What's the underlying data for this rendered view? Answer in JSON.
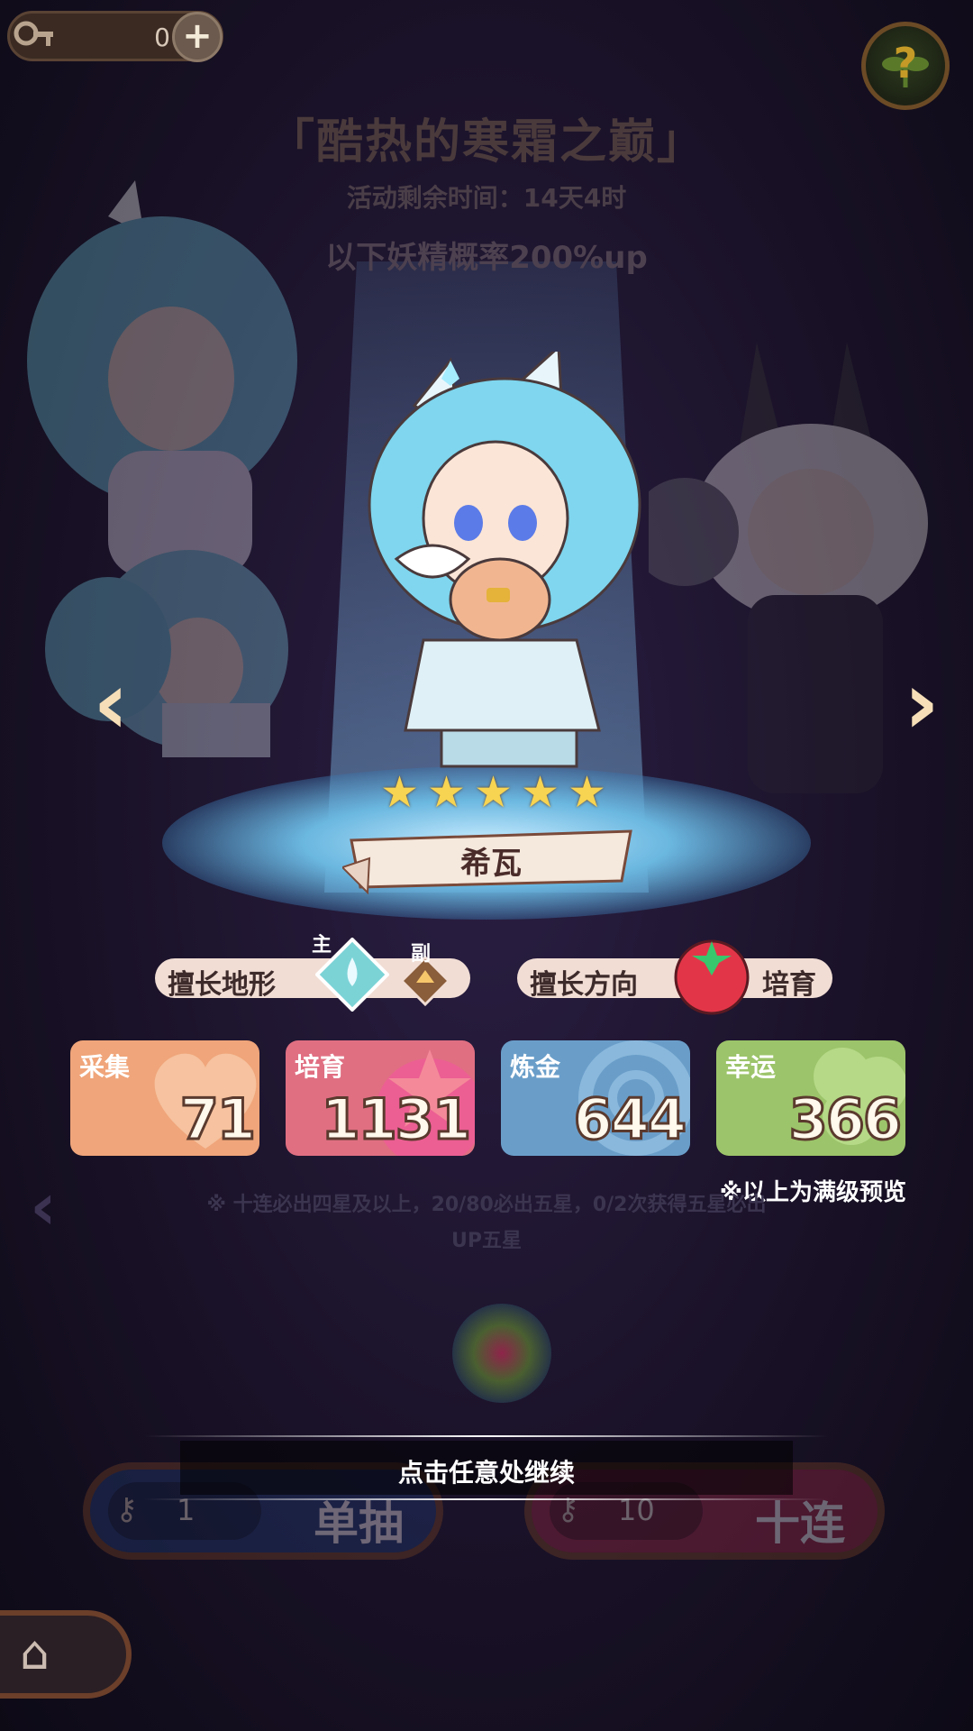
{
  "top_bar": {
    "key_count": "0",
    "add_icon": "plus-icon",
    "help_icon": "question-icon"
  },
  "event": {
    "title": "「酷热的寒霜之巅」",
    "time_left": "活动剩余时间：14天4时",
    "rate_up": "以下妖精概率200%up"
  },
  "featured": {
    "name": "希瓦",
    "stars": 5,
    "specialty_terrain_label": "擅长地形",
    "terrain_main_tag": "主",
    "terrain_sub_tag": "副",
    "specialty_direction_label": "擅长方向",
    "direction_value": "培育"
  },
  "stats": [
    {
      "label": "采集",
      "value": "71",
      "color": "#f0a57a"
    },
    {
      "label": "培育",
      "value": "1131",
      "color": "#e06f82"
    },
    {
      "label": "炼金",
      "value": "644",
      "color": "#6a9ec9"
    },
    {
      "label": "幸运",
      "value": "366",
      "color": "#9cc46a"
    }
  ],
  "preview_note": "※以上为满级预览",
  "rules": {
    "line1": "※ 十连必出四星及以上，20/80必出五星，0/2次获得五星必出",
    "line2": "UP五星"
  },
  "continue_text": "点击任意处继续",
  "draw_buttons": {
    "single": {
      "cost": "1",
      "label": "单抽"
    },
    "ten": {
      "cost": "10",
      "label": "十连"
    }
  },
  "nav": {
    "prev_arrow": "‹",
    "next_arrow": "›"
  }
}
